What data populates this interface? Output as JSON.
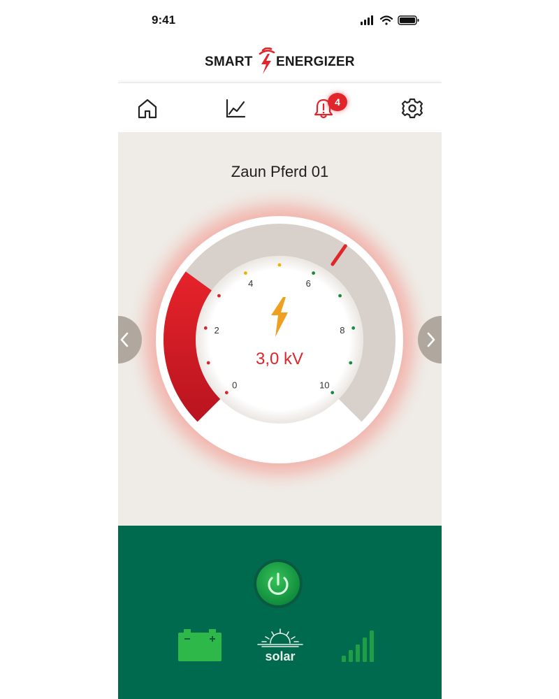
{
  "status_bar": {
    "time": "9:41"
  },
  "app": {
    "logo_left": "SMART",
    "logo_right": "ENERGIZER"
  },
  "nav": {
    "items": [
      {
        "name": "home",
        "icon": "home-icon"
      },
      {
        "name": "chart",
        "icon": "line-chart-icon"
      },
      {
        "name": "alerts",
        "icon": "bell-alert-icon"
      },
      {
        "name": "settings",
        "icon": "gear-icon"
      }
    ],
    "alert_count": "4"
  },
  "device": {
    "name": "Zaun Pferd 01"
  },
  "gauge": {
    "reading": "3,0 kV",
    "value": 3.0,
    "min": 0,
    "max": 10,
    "scale_labels": [
      "0",
      "2",
      "4",
      "6",
      "8",
      "10"
    ]
  },
  "bottom": {
    "solar_label": "solar"
  },
  "colors": {
    "accent_red": "#e0262b",
    "bolt_orange": "#f0a020",
    "green": "#006a4e",
    "light_green": "#2fb84a",
    "background": "#efebe6"
  }
}
